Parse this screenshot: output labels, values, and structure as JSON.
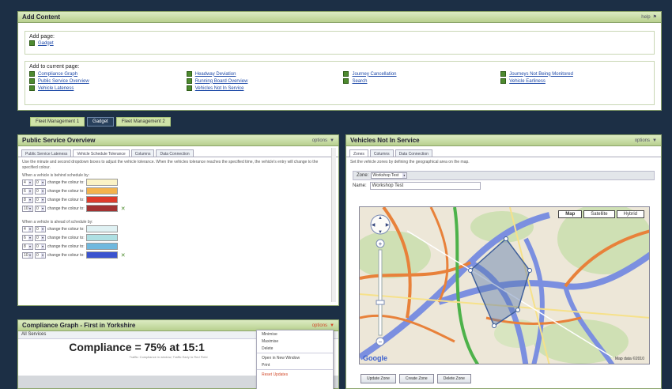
{
  "add_content": {
    "title": "Add Content",
    "help": "help",
    "add_page_label": "Add page:",
    "add_page_links": [
      "Gadget"
    ],
    "add_current_label": "Add to current page:",
    "columns": [
      [
        "Compliance Graph",
        "Public Service Overview",
        "Vehicle Lateness"
      ],
      [
        "Headway Deviation",
        "Running Board Overview",
        "Vehicles Not In Service"
      ],
      [
        "Journey Cancellation",
        "Search"
      ],
      [
        "Journeys Not Being Monitored",
        "Vehicle Earliness"
      ]
    ]
  },
  "tabs": [
    "Fleet Management 1",
    "Gadget",
    "Fleet Management 2"
  ],
  "active_tab": 1,
  "pso": {
    "title": "Public Service Overview",
    "options": "options",
    "subtabs": [
      "Public Service Lateness",
      "Vehicle Schedule Tolerance",
      "Columns",
      "Data Connection"
    ],
    "active_subtab": 1,
    "description": "Use the minute and second dropdown boxes to adjust the vehicle tolerance. When the vehicles tolerance reaches the specified time, the vehicle's entry will change to the specified colour.",
    "behind_label": "When a vehicle is behind schedule by:",
    "ahead_label": "When a vehicle is ahead of schedule by:",
    "change_text": "change the colour to:",
    "behind_rows": [
      {
        "min": "4",
        "sec": "0",
        "color": "#fbf3c6"
      },
      {
        "min": "6",
        "sec": "0",
        "color": "#f3b34e"
      },
      {
        "min": "8",
        "sec": "0",
        "color": "#de3b2b"
      },
      {
        "min": "10",
        "sec": "0",
        "color": "#a23131"
      }
    ],
    "ahead_rows": [
      {
        "min": "4",
        "sec": "0",
        "color": "#dff1f3"
      },
      {
        "min": "6",
        "sec": "0",
        "color": "#aee0e3"
      },
      {
        "min": "8",
        "sec": "0",
        "color": "#6fb8de"
      },
      {
        "min": "10",
        "sec": "0",
        "color": "#3b53cf"
      }
    ]
  },
  "vnis": {
    "title": "Vehicles Not In Service",
    "options": "options",
    "subtabs": [
      "Zones",
      "Columns",
      "Data Connection"
    ],
    "active_subtab": 0,
    "instruction": "Set the vehicle zones by defining the geographical area on the map.",
    "zone_label": "Zone:",
    "zone_value": "Workshop Test",
    "name_label": "Name:",
    "name_value": "Workshop Test",
    "map_types": [
      "Map",
      "Satellite",
      "Hybrid"
    ],
    "active_map_type": 0,
    "google": "Google",
    "scale": "Map data ©2010",
    "buttons": [
      "Update Zone",
      "Create Zone",
      "Delete Zone"
    ]
  },
  "compliance": {
    "title": "Compliance Graph - First in Yorkshire",
    "options": "options",
    "filter": "All Services",
    "headline": "Compliance = 75% at 15:1",
    "subline": "Traffic: Compliance in window; Traffic Early to Red Field",
    "menu": [
      "Minimise",
      "Maximise",
      "Delete",
      "Open in New Window",
      "Print",
      "Reset Updates"
    ],
    "menu_highlight": 5
  },
  "colors": {
    "panel_header": "#c6dca1",
    "background": "#1c2f45",
    "link": "#1f4aa8"
  }
}
